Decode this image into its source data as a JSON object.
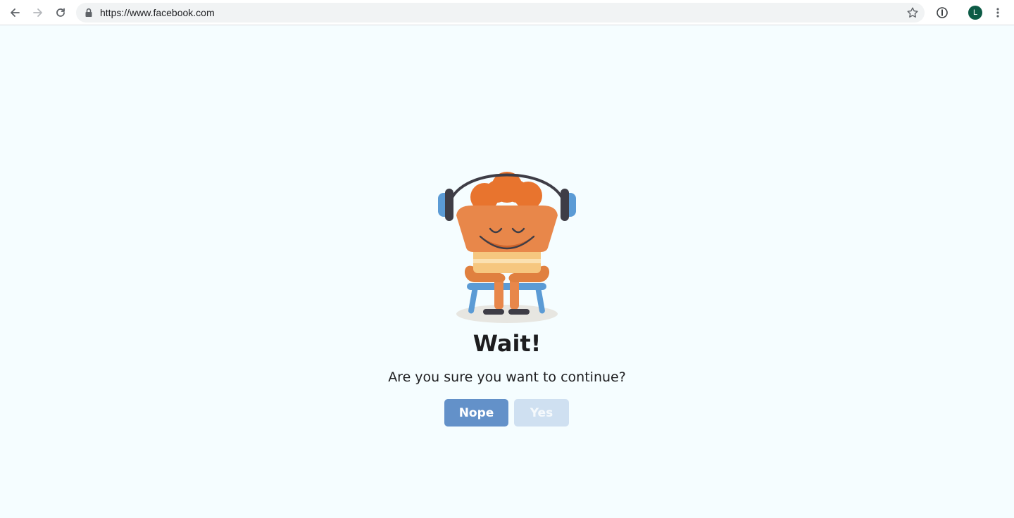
{
  "browser": {
    "url": "https://www.facebook.com",
    "avatar_initial": "L",
    "icons": {
      "back": "arrow-left-icon",
      "forward": "arrow-right-icon",
      "reload": "reload-icon",
      "lock": "lock-icon",
      "bookmark": "star-icon",
      "extension": "info-circle-icon",
      "menu": "kebab-menu-icon"
    }
  },
  "dialog": {
    "title": "Wait!",
    "message": "Are you sure you want to continue?",
    "nope_label": "Nope",
    "yes_label": "Yes"
  },
  "colors": {
    "page_background": "#f5fdff",
    "primary_button": "#6391c9",
    "disabled_button": "#cfe0f1",
    "character_orange": "#e8874a",
    "headphone_blue": "#5b9bd5",
    "avatar_green": "#0d5b46"
  }
}
